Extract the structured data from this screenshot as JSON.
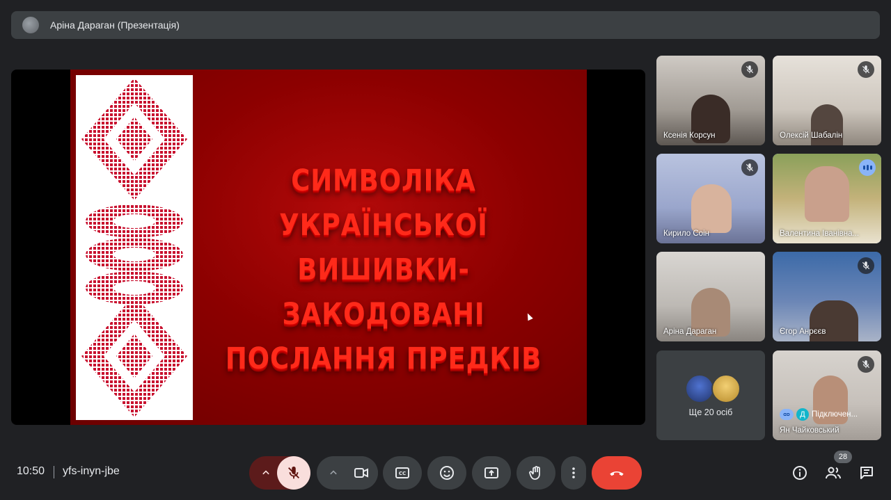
{
  "presenter_bar": {
    "title": "Аріна Дараган (Презентація)"
  },
  "presentation": {
    "slide_title_line1": "СИМВОЛІКА  УКРАЇНСЬКОЇ",
    "slide_title_line2": "ВИШИВКИ-  ЗАКОДОВАНІ",
    "slide_title_line3": "ПОСЛАННЯ ПРЕДКІВ",
    "slide_background": "#8c0000",
    "ornament_color": "#c8102e"
  },
  "participants": [
    {
      "name": "Ксенія Корсун",
      "muted": true
    },
    {
      "name": "Олексій Шабалін",
      "muted": true
    },
    {
      "name": "Кирило Соін",
      "muted": true
    },
    {
      "name": "Валентина Іванівна...",
      "muted": false,
      "speaking": true
    },
    {
      "name": "Аріна Дараган",
      "muted": false
    },
    {
      "name": "Єгор Анрєєв",
      "muted": true
    },
    {
      "name": "Ян Чайковський",
      "muted": true
    }
  ],
  "more_people": {
    "label": "Ще 20 осіб"
  },
  "connecting": {
    "initial": "Д",
    "label": "Підключен..."
  },
  "bottom_bar": {
    "time": "10:50",
    "meeting_code": "yfs-inyn-jbe",
    "people_count": "28"
  },
  "colors": {
    "accent": "#8ab4f8",
    "end_call": "#ea4335",
    "mic_off_bg": "#f9dedc"
  },
  "icons": {
    "mic": "mic-off-icon",
    "camera": "videocam-icon",
    "captions": "closed-caption-icon",
    "emoji": "emoji-icon",
    "present": "present-screen-icon",
    "hand": "raise-hand-icon",
    "more": "more-vert-icon",
    "end": "call-end-icon",
    "info": "info-icon",
    "people": "people-icon",
    "chat": "chat-icon"
  }
}
